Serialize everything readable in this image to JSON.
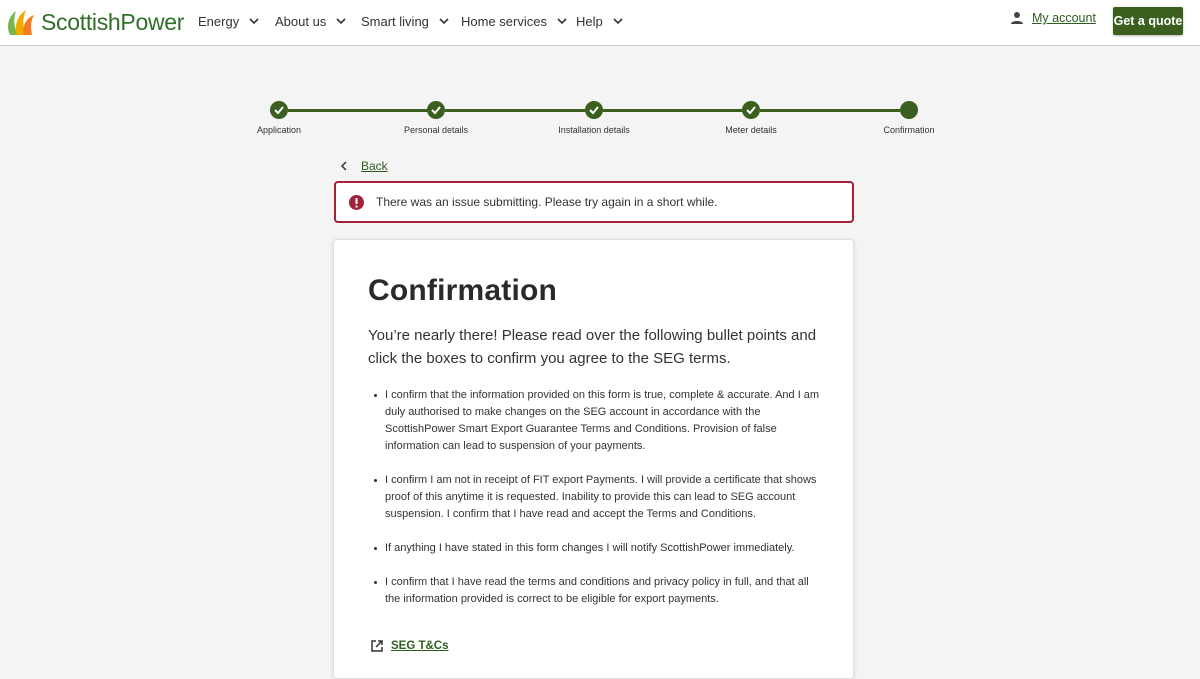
{
  "header": {
    "logo_text": "ScottishPower",
    "nav": [
      {
        "label": "Energy"
      },
      {
        "label": "About us"
      },
      {
        "label": "Smart living"
      },
      {
        "label": "Home services"
      },
      {
        "label": "Help"
      }
    ],
    "account_label": "My account",
    "quote_label": "Get a quote"
  },
  "stepper": {
    "steps": [
      {
        "label": "Application",
        "status": "complete"
      },
      {
        "label": "Personal details",
        "status": "complete"
      },
      {
        "label": "Installation details",
        "status": "complete"
      },
      {
        "label": "Meter details",
        "status": "complete"
      },
      {
        "label": "Confirmation",
        "status": "current"
      }
    ]
  },
  "back_label": "Back",
  "error": {
    "message": "There was an issue submitting. Please try again in a short while."
  },
  "card": {
    "title": "Confirmation",
    "intro": "You’re nearly there! Please read over the following bullet points and click the boxes to confirm you agree to the SEG terms.",
    "bullets": [
      "I confirm that the information provided on this form is true, complete & accurate. And I am duly authorised to make changes on the SEG account in accordance with the ScottishPower Smart Export Guarantee Terms and Conditions. Provision of false information can lead to suspension of your payments.",
      "I confirm I am not in receipt of FIT export Payments. I will provide a certificate that shows proof of this anytime it is requested. Inability to provide this can lead to SEG account suspension. I confirm that I have read and accept the Terms and Conditions.",
      "If anything I have stated in this form changes I will notify ScottishPower immediately.",
      "I confirm that I have read the terms and conditions and privacy policy in full, and that all the information provided is correct to be eligible for export payments."
    ],
    "link_label": "SEG T&Cs"
  },
  "colors": {
    "brand_green": "#3a5f1e",
    "error_red": "#a3223a"
  }
}
